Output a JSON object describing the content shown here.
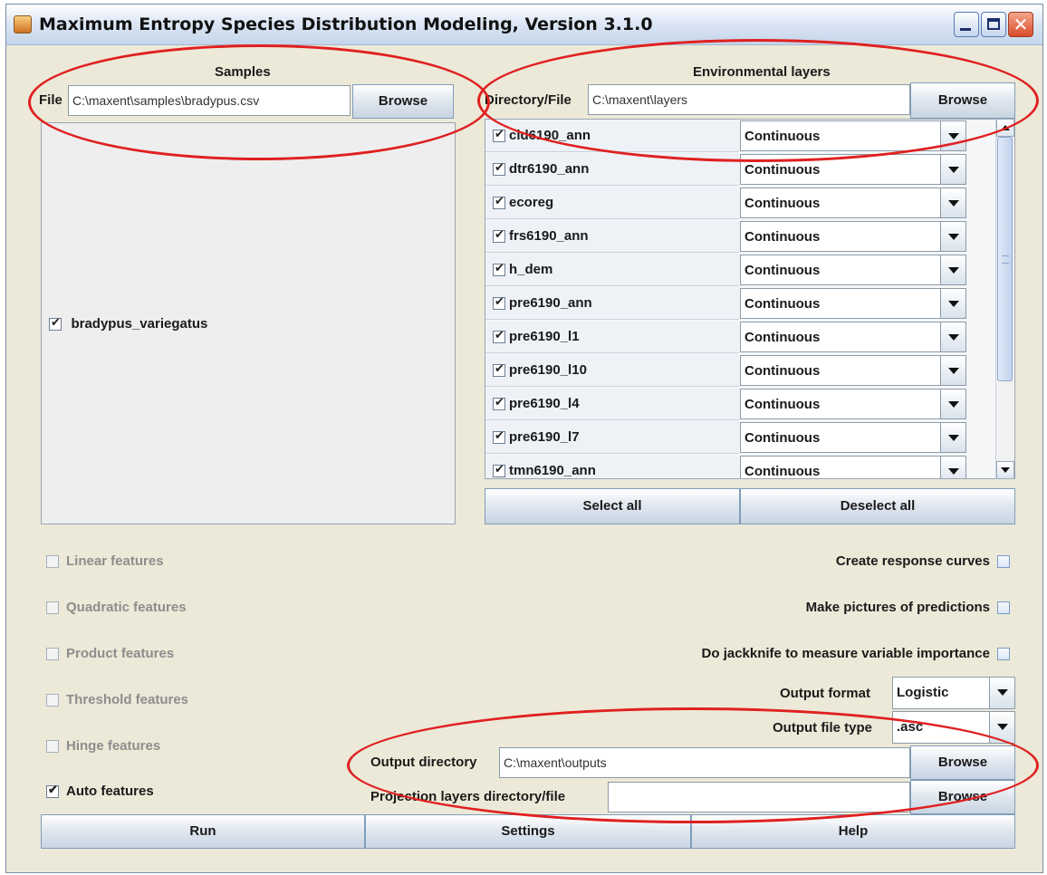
{
  "window": {
    "title": "Maximum Entropy Species Distribution Modeling, Version 3.1.0"
  },
  "samples": {
    "heading": "Samples",
    "file_label": "File",
    "file_value": "C:\\maxent\\samples\\bradypus.csv",
    "browse": "Browse",
    "species": [
      {
        "name": "bradypus_variegatus",
        "checked": true
      }
    ]
  },
  "env": {
    "heading": "Environmental layers",
    "dir_label": "Directory/File",
    "dir_value": "C:\\maxent\\layers",
    "browse": "Browse",
    "layers": [
      {
        "name": "cld6190_ann",
        "type": "Continuous",
        "checked": true
      },
      {
        "name": "dtr6190_ann",
        "type": "Continuous",
        "checked": true
      },
      {
        "name": "ecoreg",
        "type": "Continuous",
        "checked": true
      },
      {
        "name": "frs6190_ann",
        "type": "Continuous",
        "checked": true
      },
      {
        "name": "h_dem",
        "type": "Continuous",
        "checked": true
      },
      {
        "name": "pre6190_ann",
        "type": "Continuous",
        "checked": true
      },
      {
        "name": "pre6190_l1",
        "type": "Continuous",
        "checked": true
      },
      {
        "name": "pre6190_l10",
        "type": "Continuous",
        "checked": true
      },
      {
        "name": "pre6190_l4",
        "type": "Continuous",
        "checked": true
      },
      {
        "name": "pre6190_l7",
        "type": "Continuous",
        "checked": true
      },
      {
        "name": "tmn6190_ann",
        "type": "Continuous",
        "checked": true
      }
    ],
    "select_all": "Select all",
    "deselect_all": "Deselect all"
  },
  "features": {
    "linear": "Linear features",
    "quadratic": "Quadratic features",
    "product": "Product features",
    "threshold": "Threshold features",
    "hinge": "Hinge features",
    "auto": "Auto features"
  },
  "options": {
    "response_curves": "Create response curves",
    "pictures": "Make pictures of predictions",
    "jackknife": "Do jackknife to measure variable importance",
    "output_format_label": "Output format",
    "output_format_value": "Logistic",
    "output_file_type_label": "Output file type",
    "output_file_type_value": ".asc",
    "output_dir_label": "Output directory",
    "output_dir_value": "C:\\maxent\\outputs",
    "projection_label": "Projection layers directory/file",
    "projection_value": "",
    "browse": "Browse"
  },
  "buttons": {
    "run": "Run",
    "settings": "Settings",
    "help": "Help"
  },
  "colors": {
    "annotation": "#e02020",
    "window_bg": "#ece9d8"
  }
}
